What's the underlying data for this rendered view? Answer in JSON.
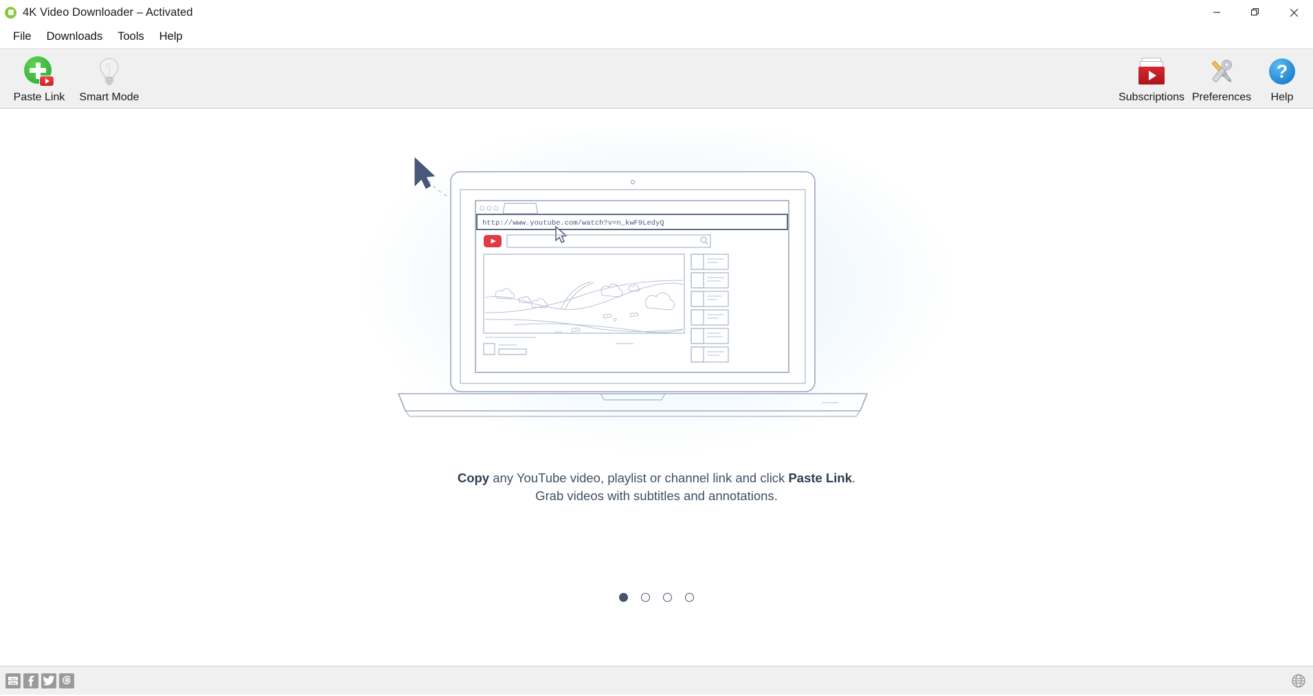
{
  "window": {
    "title": "4K Video Downloader – Activated",
    "app_icon": "app-logo-icon",
    "controls": {
      "minimize": "minimize-icon",
      "restore": "restore-icon",
      "close": "close-icon"
    }
  },
  "menu": {
    "items": [
      {
        "label": "File"
      },
      {
        "label": "Downloads"
      },
      {
        "label": "Tools"
      },
      {
        "label": "Help"
      }
    ]
  },
  "toolbar": {
    "left": [
      {
        "label": "Paste Link",
        "icon": "paste-link-icon"
      },
      {
        "label": "Smart Mode",
        "icon": "lightbulb-icon"
      }
    ],
    "right": [
      {
        "label": "Subscriptions",
        "icon": "subscriptions-folder-icon"
      },
      {
        "label": "Preferences",
        "icon": "wrench-screwdriver-icon"
      },
      {
        "label": "Help",
        "icon": "help-question-icon"
      }
    ]
  },
  "hero": {
    "illustration_name": "laptop-youtube-illustration",
    "browser_url": "http://www.youtube.com/watch?v=n_kwF9LedyQ",
    "youtube_logo": "youtube-play-logo",
    "search_placeholder": "",
    "search_icon": "magnifier-icon",
    "cursor_icon": "arrow-cursor",
    "sidebar_item_count": 6
  },
  "caption": {
    "line1_bold_start": "Copy",
    "line1_mid": " any YouTube video, playlist or channel link and click ",
    "line1_bold_end": "Paste Link",
    "line1_period": ".",
    "line2": "Grab videos with subtitles and annotations."
  },
  "carousel": {
    "total": 4,
    "active_index": 0,
    "dots": [
      {
        "active": true
      },
      {
        "active": false
      },
      {
        "active": false
      },
      {
        "active": false
      }
    ]
  },
  "statusbar": {
    "social": [
      {
        "name": "youtube-icon",
        "label": "YouTube"
      },
      {
        "name": "facebook-icon",
        "label": "Facebook"
      },
      {
        "name": "twitter-icon",
        "label": "Twitter"
      },
      {
        "name": "instagram-icon",
        "label": "Instagram"
      }
    ],
    "language": {
      "name": "globe-icon",
      "label": "Language"
    }
  },
  "colors": {
    "accent_green": "#2faf3c",
    "accent_red": "#cf2027",
    "accent_blue": "#1679c8",
    "text_dark": "#1a1a1a",
    "caption_text": "#3f4f63",
    "toolbar_bg": "#f0f0f0",
    "illustration_stroke": "#8e9bb3"
  }
}
